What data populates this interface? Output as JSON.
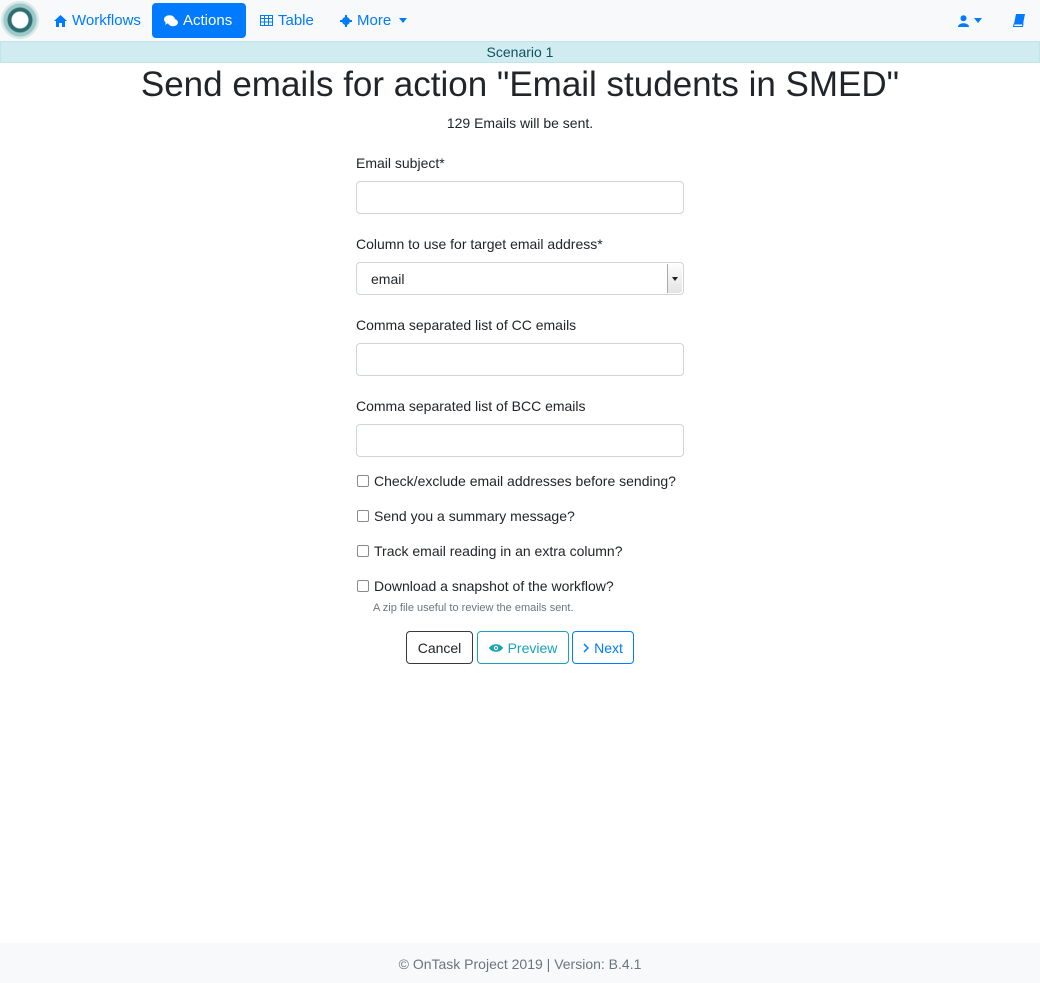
{
  "nav": {
    "workflows": "Workflows",
    "actions": "Actions",
    "table": "Table",
    "more": "More",
    "icons": {
      "workflows": "home-icon",
      "actions": "comments-icon",
      "table": "table-icon",
      "more": "cog-icon",
      "user": "user-icon",
      "docs": "book-icon"
    },
    "accent": "#007bff"
  },
  "scenario": "Scenario 1",
  "page": {
    "title": "Send emails for action \"Email students in SMED\"",
    "count_text": "129 Emails will be sent."
  },
  "form": {
    "subject_label": "Email subject*",
    "subject_value": "",
    "column_label": "Column to use for target email address*",
    "column_value": "email",
    "cc_label": "Comma separated list of CC emails",
    "cc_value": "",
    "bcc_label": "Comma separated list of BCC emails",
    "bcc_value": "",
    "check_exclude": "Check/exclude email addresses before sending?",
    "send_summary": "Send you a summary message?",
    "track_reading": "Track email reading in an extra column?",
    "download_snapshot": "Download a snapshot of the workflow?",
    "snapshot_help": "A zip file useful to review the emails sent."
  },
  "buttons": {
    "cancel": "Cancel",
    "preview": "Preview",
    "next": "Next"
  },
  "footer": "© OnTask Project 2019 | Version: B.4.1"
}
